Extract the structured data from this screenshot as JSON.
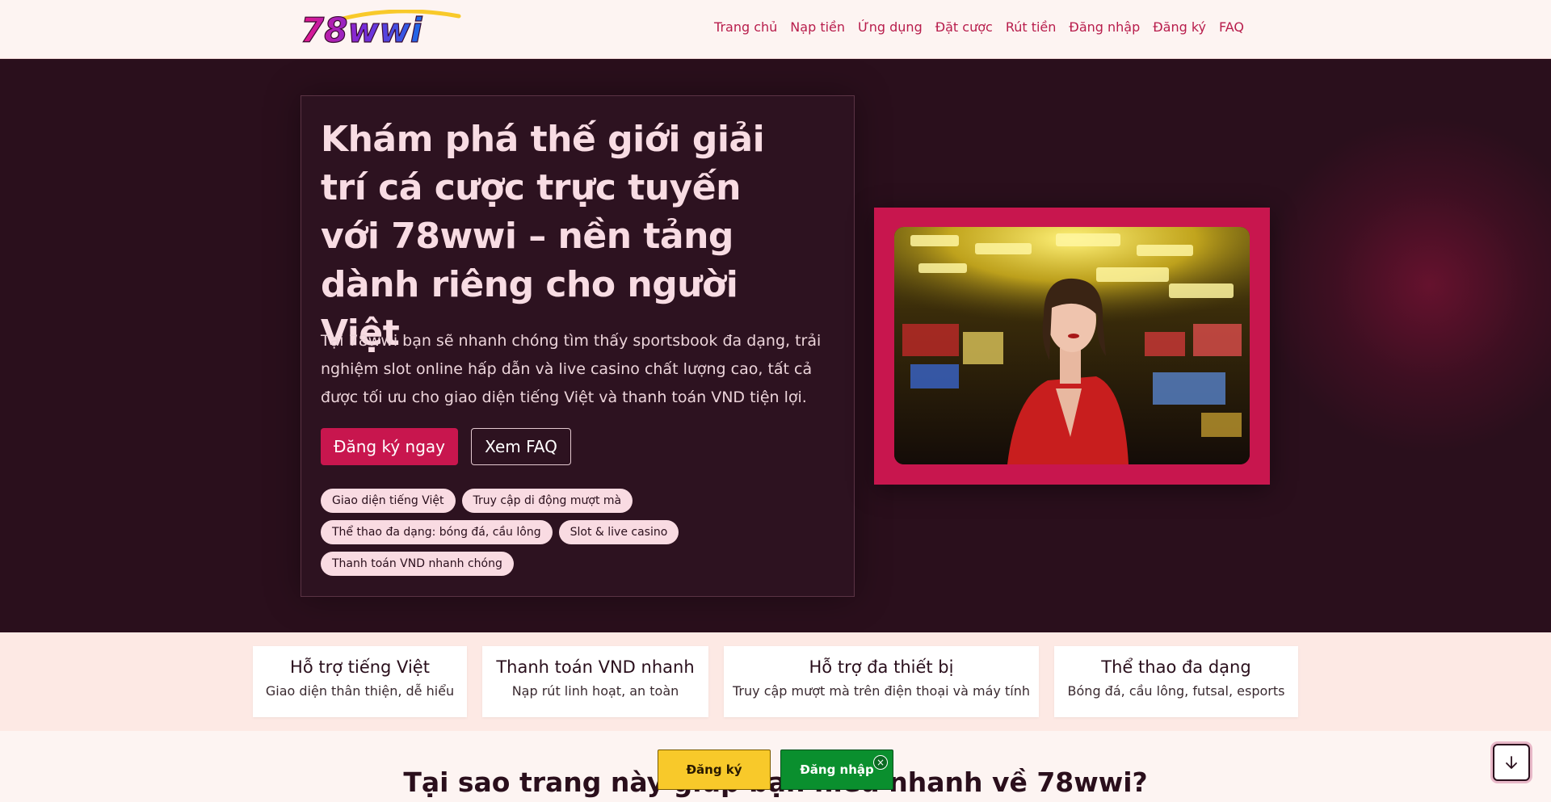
{
  "header": {
    "logo_text": "78wwi",
    "nav": [
      "Trang chủ",
      "Nạp tiền",
      "Ứng dụng",
      "Đặt cược",
      "Rút tiền",
      "Đăng nhập",
      "Đăng ký",
      "FAQ"
    ]
  },
  "hero": {
    "title": "Khám phá thế giới giải trí cá cược trực tuyến với 78wwi – nền tảng dành riêng cho người Việt",
    "description": "Tại 78wwi bạn sẽ nhanh chóng tìm thấy sportsbook đa dạng, trải nghiệm slot online hấp dẫn và live casino chất lượng cao, tất cả được tối ưu cho giao diện tiếng Việt và thanh toán VND tiện lợi.",
    "primary_button": "Đăng ký ngay",
    "secondary_button": "Xem FAQ",
    "chips": [
      "Giao diện tiếng Việt",
      "Truy cập di động mượt mà",
      "Thể thao đa dạng: bóng đá, cầu lông",
      "Slot & live casino",
      "Thanh toán VND nhanh chóng"
    ]
  },
  "features": [
    {
      "title": "Hỗ trợ tiếng Việt",
      "desc": "Giao diện thân thiện, dễ hiểu"
    },
    {
      "title": "Thanh toán VND nhanh",
      "desc": "Nạp rút linh hoạt, an toàn"
    },
    {
      "title": "Hỗ trợ đa thiết bị",
      "desc": "Truy cập mượt mà trên điện thoại và máy tính"
    },
    {
      "title": "Thể thao đa dạng",
      "desc": "Bóng đá, cầu lông, futsal, esports"
    }
  ],
  "section_title": "Tại sao trang này giúp bạn hiểu nhanh về 78wwi?",
  "sticky": {
    "register": "Đăng ký",
    "login": "Đăng nhập",
    "close": "×"
  },
  "colors": {
    "accent": "#c8164e",
    "hero_bg": "#2a0f1c",
    "register": "#f8c92a",
    "login": "#0a8f2e"
  },
  "icons": {
    "scroll": "arrow-down-icon",
    "close": "close-icon"
  }
}
